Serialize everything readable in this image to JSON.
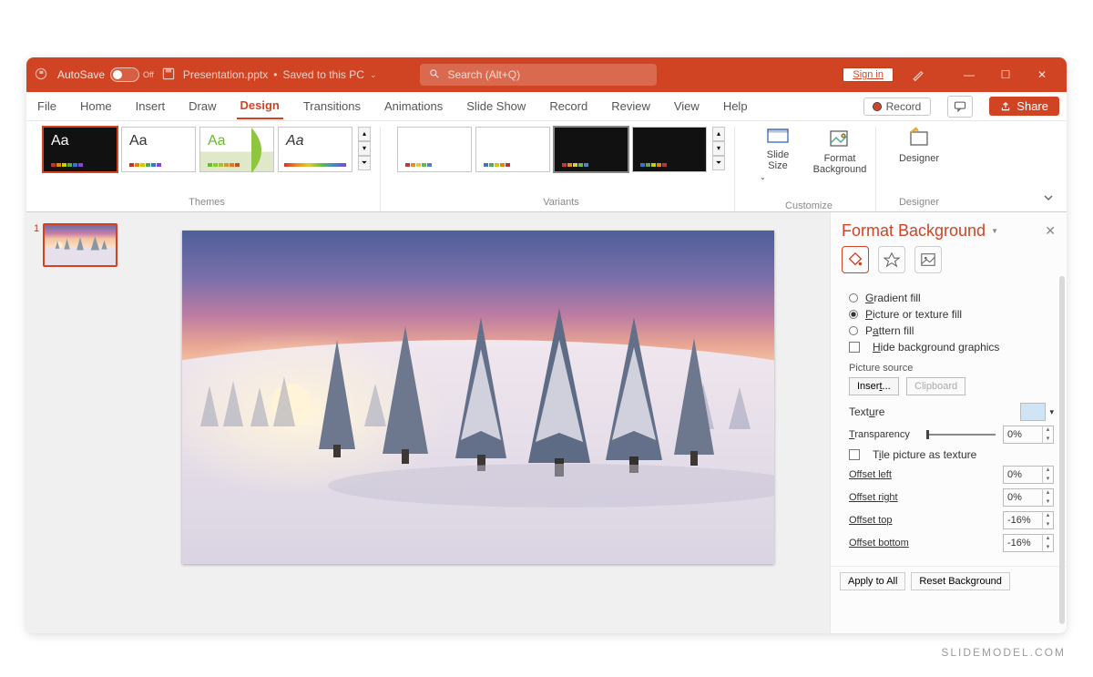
{
  "titlebar": {
    "autosave": "AutoSave",
    "autosave_state": "Off",
    "filename": "Presentation.pptx",
    "saved_status": "Saved to this PC",
    "search_placeholder": "Search (Alt+Q)",
    "signin": "Sign in"
  },
  "tabs": {
    "file": "File",
    "home": "Home",
    "insert": "Insert",
    "draw": "Draw",
    "design": "Design",
    "transitions": "Transitions",
    "animations": "Animations",
    "slideshow": "Slide Show",
    "record": "Record",
    "review": "Review",
    "view": "View",
    "help": "Help"
  },
  "topright": {
    "record": "Record",
    "share": "Share"
  },
  "groups": {
    "themes": "Themes",
    "variants": "Variants",
    "customize": "Customize",
    "designer": "Designer"
  },
  "customize": {
    "slide_size": "Slide Size",
    "format_bg": "Format Background"
  },
  "designer_btn": "Designer",
  "thumb_number": "1",
  "panel": {
    "title": "Format Background",
    "fill_options": {
      "gradient": "Gradient fill",
      "picture": "Picture or texture fill",
      "pattern": "Pattern fill"
    },
    "hide_bg": "Hide background graphics",
    "picture_source": "Picture source",
    "insert": "Insert...",
    "clipboard": "Clipboard",
    "texture": "Texture",
    "transparency": "Transparency",
    "transparency_val": "0%",
    "tile": "Tile picture as texture",
    "offsets": {
      "left": {
        "label": "Offset left",
        "val": "0%"
      },
      "right": {
        "label": "Offset right",
        "val": "0%"
      },
      "top": {
        "label": "Offset top",
        "val": "-16%"
      },
      "bottom": {
        "label": "Offset bottom",
        "val": "-16%"
      }
    },
    "apply_all": "Apply to All",
    "reset": "Reset Background"
  },
  "watermark": "SLIDEMODEL.COM"
}
